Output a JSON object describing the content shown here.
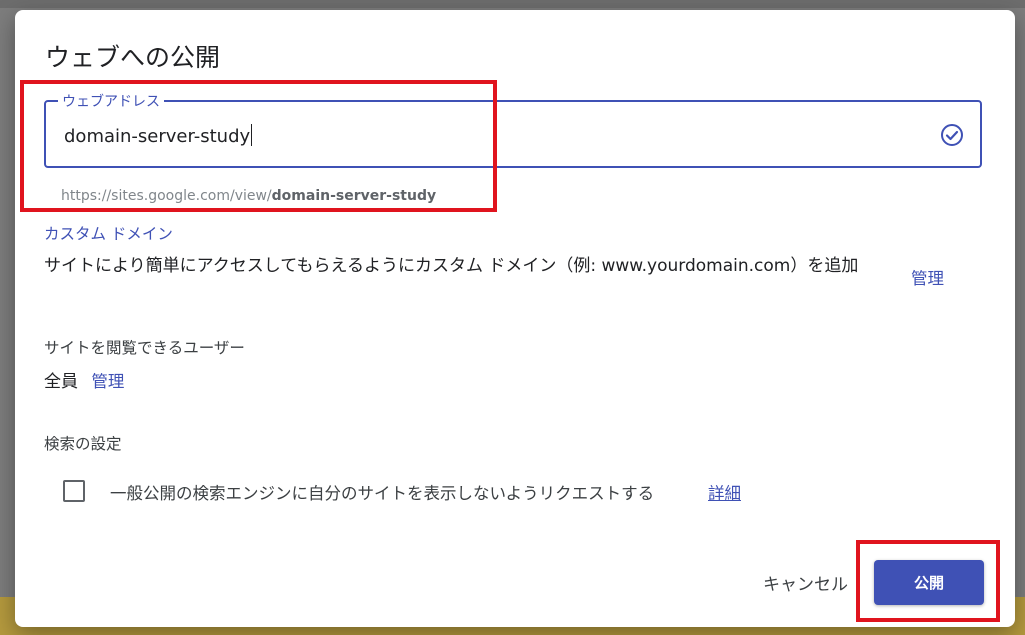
{
  "dialog": {
    "title": "ウェブへの公開",
    "url_field": {
      "label": "ウェブアドレス",
      "value": "domain-server-study",
      "preview_prefix": "https://sites.google.com/view/",
      "preview_slug": "domain-server-study"
    },
    "custom_domain": {
      "title": "カスタム ドメイン",
      "description": "サイトにより簡単にアクセスしてもらえるようにカスタム ドメイン（例: www.yourdomain.com）を追加",
      "manage_label": "管理"
    },
    "viewers": {
      "heading": "サイトを閲覧できるユーザー",
      "value": "全員",
      "manage_label": "管理"
    },
    "search": {
      "heading": "検索の設定",
      "checkbox_label": "一般公開の検索エンジンに自分のサイトを表示しないようリクエストする",
      "checkbox_checked": false,
      "detail_link": "詳細"
    },
    "actions": {
      "cancel_label": "キャンセル",
      "publish_label": "公開"
    }
  },
  "colors": {
    "accent": "#3f51b5",
    "highlight": "#e0141e"
  },
  "icons": {
    "valid": "check-circle-icon"
  }
}
